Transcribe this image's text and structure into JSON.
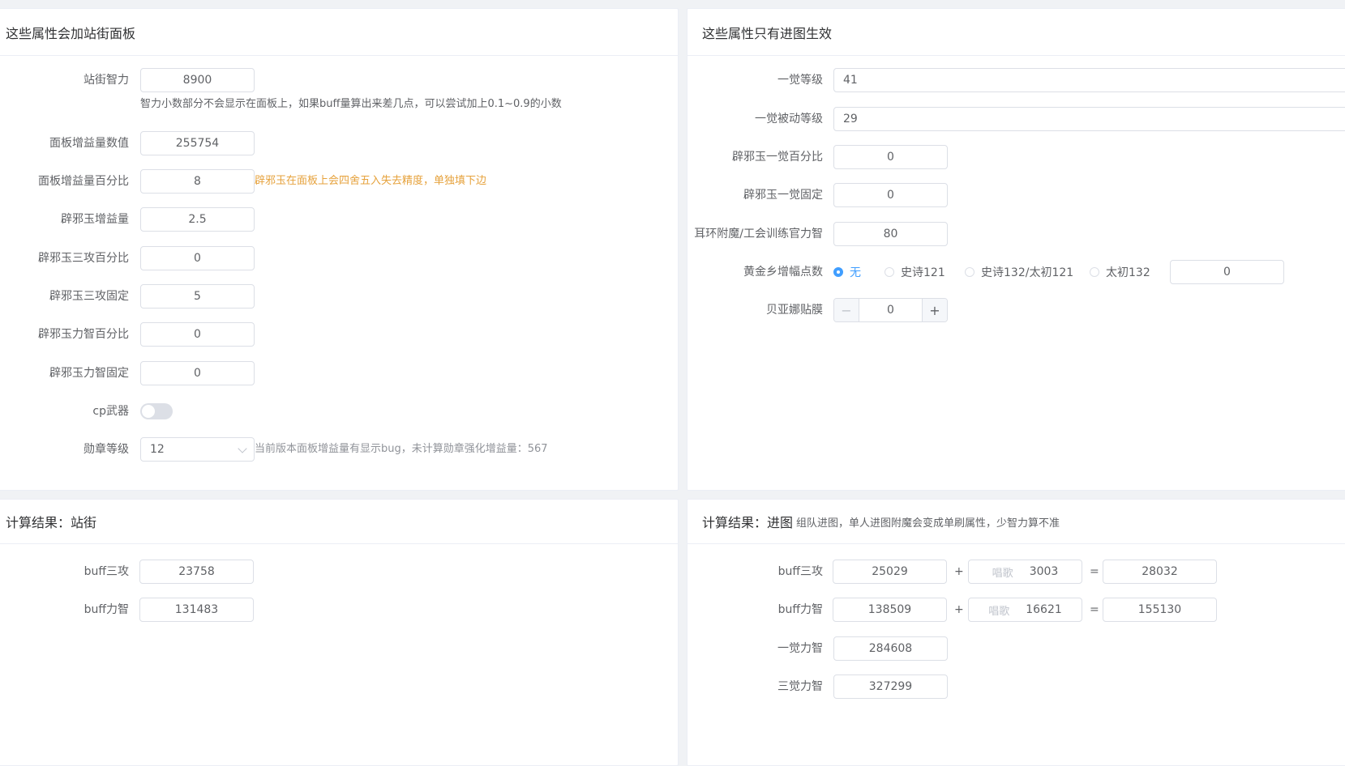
{
  "left_panel": {
    "title": "这些属性会加站街面板",
    "fields": {
      "zhanjie_zhili": {
        "label": "站街智力",
        "value": "8900"
      },
      "zhili_hint": "智力小数部分不会显示在面板上，如果buff量算出来差几点，可以尝试加上0.1~0.9的小数",
      "panel_value": {
        "label": "面板增益量数值",
        "value": "255754"
      },
      "panel_percent": {
        "label": "面板增益量百分比",
        "value": "8"
      },
      "panel_percent_hint": "辟邪玉在面板上会四舍五入失去精度，单独填下边",
      "pixie_gain": {
        "label": "辟邪玉增益量",
        "value": "2.5"
      },
      "pixie_sangong_pct": {
        "label": "辟邪玉三攻百分比",
        "value": "0"
      },
      "pixie_sangong_fixed": {
        "label": "辟邪玉三攻固定",
        "value": "5"
      },
      "pixie_lizhi_pct": {
        "label": "辟邪玉力智百分比",
        "value": "0"
      },
      "pixie_lizhi_fixed": {
        "label": "辟邪玉力智固定",
        "value": "0"
      },
      "cp_weapon": {
        "label": "cp武器",
        "on": false
      },
      "medal_level": {
        "label": "勋章等级",
        "value": "12"
      },
      "medal_hint": "当前版本面板增益量有显示bug，未计算勋章强化增益量：567"
    }
  },
  "right_panel": {
    "title": "这些属性只有进图生效",
    "fields": {
      "awaken_level": {
        "label": "一觉等级",
        "value": "41"
      },
      "awaken_passive": {
        "label": "一觉被动等级",
        "value": "29"
      },
      "pixie_awaken_pct": {
        "label": "辟邪玉一觉百分比",
        "value": "0"
      },
      "pixie_awaken_fixed": {
        "label": "辟邪玉一觉固定",
        "value": "0"
      },
      "earring": {
        "label": "耳环附魔/工会训练官力智",
        "value": "80"
      },
      "golden": {
        "label": "黄金乡增幅点数",
        "options": [
          "无",
          "史诗121",
          "史诗132/太初121",
          "太初132"
        ],
        "selected": "无",
        "custom_value": "0"
      },
      "beiyana": {
        "label": "贝亚娜贴膜",
        "value": "0",
        "minus": "−",
        "plus": "+"
      }
    }
  },
  "result_street": {
    "title": "计算结果：站街",
    "buff_sangong": {
      "label": "buff三攻",
      "value": "23758"
    },
    "buff_lizhi": {
      "label": "buff力智",
      "value": "131483"
    }
  },
  "result_dungeon": {
    "title": "计算结果：进图",
    "subtitle": "组队进图，单人进图附魔会变成单刷属性，少智力算不准",
    "plus": "+",
    "equals": "=",
    "buff_sangong": {
      "label": "buff三攻",
      "base": "25029",
      "song_prefix": "唱歌",
      "song": "3003",
      "total": "28032"
    },
    "buff_lizhi": {
      "label": "buff力智",
      "base": "138509",
      "song_prefix": "唱歌",
      "song": "16621",
      "total": "155130"
    },
    "awaken1": {
      "label": "一觉力智",
      "value": "284608"
    },
    "awaken3": {
      "label": "三觉力智",
      "value": "327299"
    }
  }
}
